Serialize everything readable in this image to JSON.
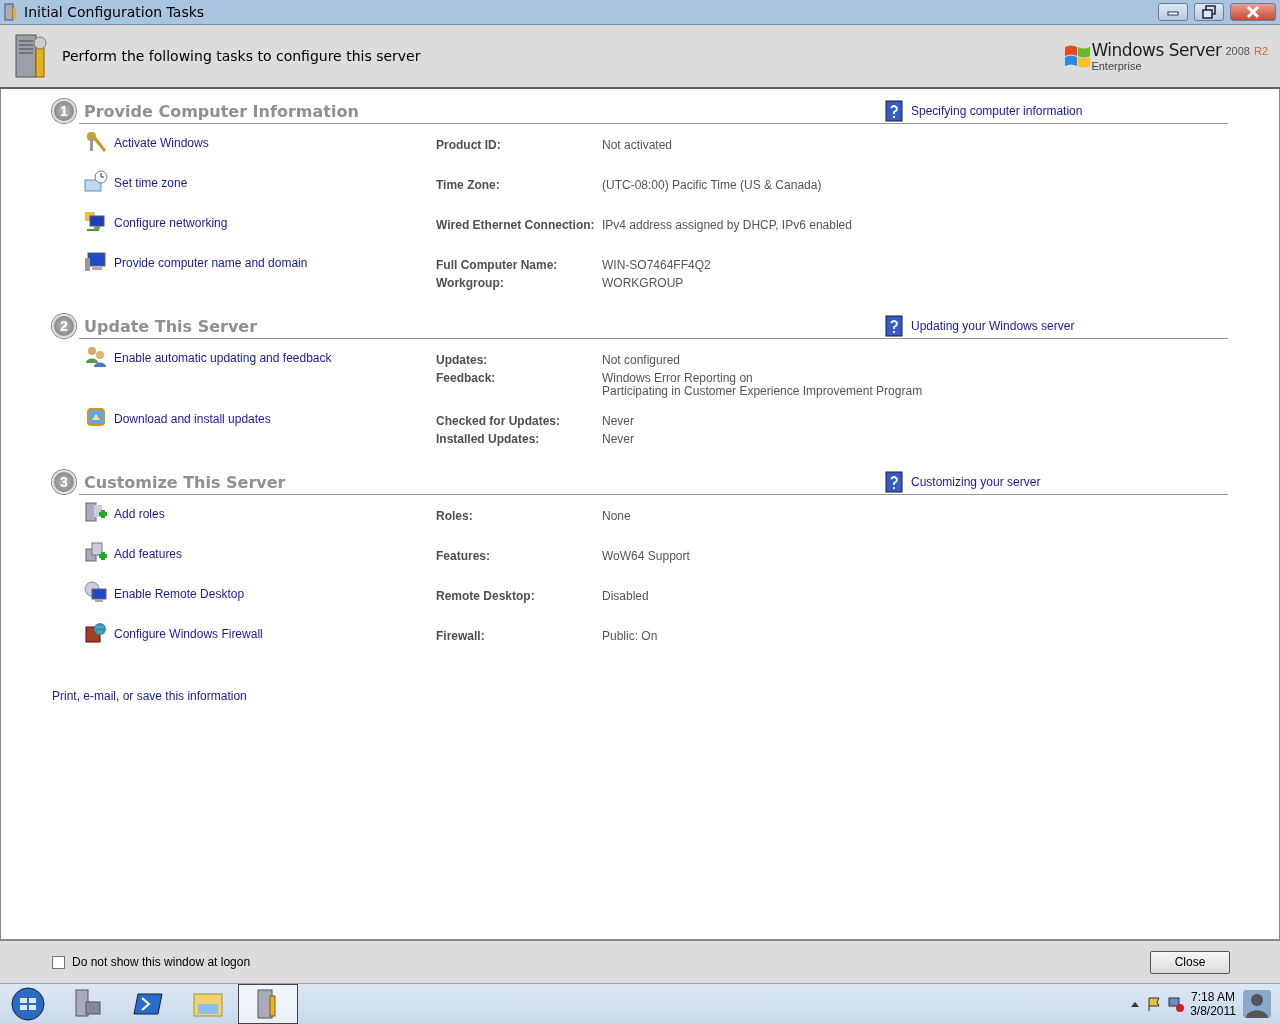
{
  "window": {
    "title": "Initial Configuration Tasks"
  },
  "header": {
    "text": "Perform the following tasks to configure this server",
    "brand": {
      "name": "Windows Server",
      "version": "2008",
      "release": "R2",
      "edition": "Enterprise"
    }
  },
  "sections": [
    {
      "number": "1",
      "title": "Provide Computer Information",
      "help_link": "Specifying computer information",
      "tasks": [
        {
          "kind": "key",
          "label": "Activate Windows",
          "info": [
            {
              "label": "Product ID:",
              "value": [
                "Not activated"
              ]
            }
          ]
        },
        {
          "kind": "clock",
          "label": "Set time zone",
          "info": [
            {
              "label": "Time Zone:",
              "value": [
                "(UTC-08:00) Pacific Time (US & Canada)"
              ]
            }
          ]
        },
        {
          "kind": "network",
          "label": "Configure networking",
          "info": [
            {
              "label": "Wired Ethernet Connection:",
              "value": [
                "IPv4 address assigned by DHCP, IPv6 enabled"
              ]
            }
          ]
        },
        {
          "kind": "computer",
          "label": "Provide computer name and domain",
          "info": [
            {
              "label": "Full Computer Name:",
              "value": [
                "WIN-SO7464FF4Q2"
              ]
            },
            {
              "label": "Workgroup:",
              "value": [
                "WORKGROUP"
              ]
            }
          ]
        }
      ]
    },
    {
      "number": "2",
      "title": "Update This Server",
      "help_link": "Updating your Windows server",
      "tasks": [
        {
          "kind": "users",
          "label": "Enable automatic updating and feedback",
          "info": [
            {
              "label": "Updates:",
              "value": [
                "Not configured"
              ]
            },
            {
              "label": "Feedback:",
              "value": [
                "Windows Error Reporting on",
                "Participating in Customer Experience Improvement Program"
              ]
            }
          ]
        },
        {
          "kind": "update",
          "label": "Download and install updates",
          "info": [
            {
              "label": "Checked for Updates:",
              "value": [
                "Never"
              ]
            },
            {
              "label": "Installed Updates:",
              "value": [
                "Never"
              ]
            }
          ]
        }
      ]
    },
    {
      "number": "3",
      "title": "Customize This Server",
      "help_link": "Customizing your server",
      "tasks": [
        {
          "kind": "roles",
          "label": "Add roles",
          "info": [
            {
              "label": "Roles:",
              "value": [
                "None"
              ]
            }
          ]
        },
        {
          "kind": "features",
          "label": "Add features",
          "info": [
            {
              "label": "Features:",
              "value": [
                "WoW64 Support"
              ]
            }
          ]
        },
        {
          "kind": "remote",
          "label": "Enable Remote Desktop",
          "info": [
            {
              "label": "Remote Desktop:",
              "value": [
                "Disabled"
              ]
            }
          ]
        },
        {
          "kind": "firewall",
          "label": "Configure Windows Firewall",
          "info": [
            {
              "label": "Firewall:",
              "value": [
                "Public: On"
              ]
            }
          ]
        }
      ]
    }
  ],
  "print_link": "Print, e-mail, or save this information",
  "footer": {
    "checkbox": {
      "label": "Do not show this window at logon",
      "checked": false
    },
    "button": "Close"
  },
  "taskbar": {
    "items": [
      {
        "kind": "server",
        "selected": false
      },
      {
        "kind": "powershell",
        "selected": false
      },
      {
        "kind": "explorer",
        "selected": false
      },
      {
        "kind": "config",
        "selected": true
      }
    ],
    "clock": {
      "time": "7:18 AM",
      "date": "3/8/2011"
    }
  }
}
